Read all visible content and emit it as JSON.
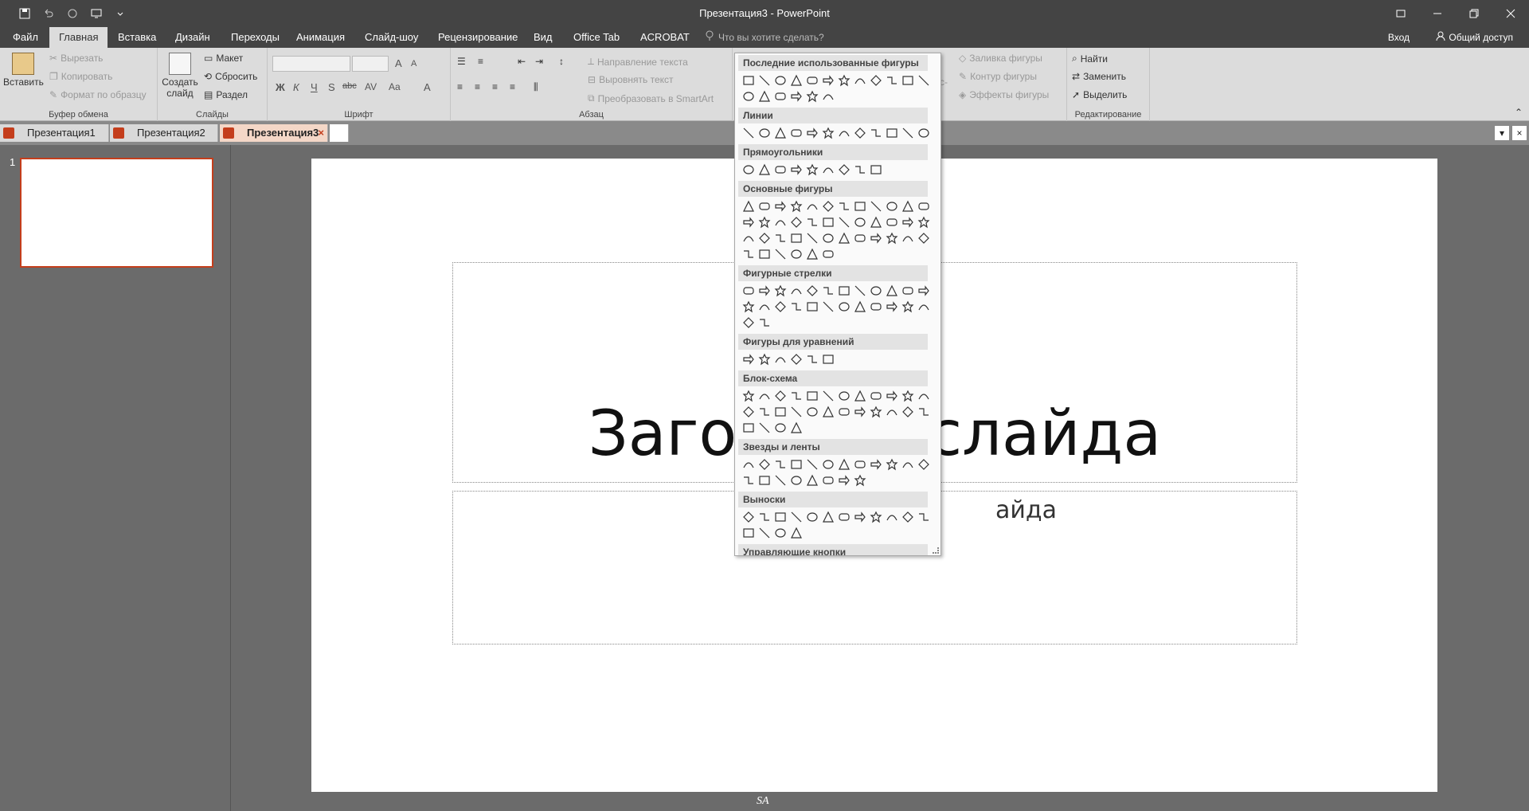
{
  "app": {
    "title": "Презентация3 - PowerPoint"
  },
  "ribbon_tabs": [
    "Файл",
    "Главная",
    "Вставка",
    "Дизайн",
    "Переходы",
    "Анимация",
    "Слайд-шоу",
    "Рецензирование",
    "Вид",
    "Office Tab",
    "ACROBAT"
  ],
  "tell_me": "Что вы хотите сделать?",
  "account": {
    "signin": "Вход",
    "share": "Общий доступ"
  },
  "clipboard": {
    "paste": "Вставить",
    "cut": "Вырезать",
    "copy": "Копировать",
    "format_painter": "Формат по образцу",
    "label": "Буфер обмена"
  },
  "slides_group": {
    "new_slide": "Создать слайд",
    "layout": "Макет",
    "reset": "Сбросить",
    "section": "Раздел",
    "label": "Слайды"
  },
  "font_group": {
    "label": "Шрифт",
    "bold": "Ж",
    "italic": "К",
    "underline": "Ч",
    "shadow": "S",
    "strike": "abc",
    "spacing": "AV",
    "case": "Aa",
    "color": "A",
    "grow": "A",
    "shrink": "A"
  },
  "paragraph_group": {
    "label": "Абзац",
    "text_direction": "Направление текста",
    "align_text": "Выровнять текст",
    "smartart": "Преобразовать в SmartArt"
  },
  "drawing_group": {
    "fill": "Заливка фигуры",
    "outline": "Контур фигуры",
    "effects": "Эффекты фигуры",
    "partial": "сс-"
  },
  "editing_group": {
    "find": "Найти",
    "replace": "Заменить",
    "select": "Выделить",
    "label": "Редактирование"
  },
  "doc_tabs": [
    {
      "label": "Презентация1",
      "active": false
    },
    {
      "label": "Презентация2",
      "active": false
    },
    {
      "label": "Презентация3",
      "active": true
    }
  ],
  "thumbnail": {
    "number": "1"
  },
  "slide": {
    "title_visible_left": "Заго",
    "title_visible_right": "слайда",
    "subtitle_visible": "айда"
  },
  "signature": "SA",
  "shapes_gallery": {
    "sections": [
      {
        "name": "Последние использованные фигуры",
        "shapes": [
          "text-box",
          "line",
          "line-diagonal",
          "rectangle",
          "oval",
          "rounded-rectangle",
          "triangle",
          "elbow-connector",
          "elbow-arrow-connector",
          "right-arrow",
          "down-arrow",
          "snip-rectangle",
          "freeform",
          "arc",
          "curve",
          "left-brace",
          "right-brace",
          "star"
        ]
      },
      {
        "name": "Линии",
        "shapes": [
          "line",
          "arrow-line",
          "double-arrow-line",
          "elbow",
          "elbow-arrow",
          "elbow-double-arrow",
          "curve-connector",
          "curve-arrow",
          "curve-double-arrow",
          "curve",
          "freeform",
          "scribble"
        ]
      },
      {
        "name": "Прямоугольники",
        "shapes": [
          "rect",
          "rounded-rect",
          "snip-one",
          "snip-two",
          "snip-diag",
          "snip-round",
          "round-one",
          "round-two",
          "round-diag"
        ]
      },
      {
        "name": "Основные фигуры",
        "shapes": [
          "text-box",
          "oval",
          "triangle",
          "right-triangle",
          "parallelogram",
          "trapezoid",
          "diamond",
          "pentagon",
          "hexagon",
          "heptagon",
          "octagon",
          "decagon",
          "dodecagon",
          "pie",
          "chord",
          "teardrop",
          "frame",
          "half-frame",
          "l-shape",
          "diag-stripe",
          "cross",
          "plaque",
          "can",
          "cube",
          "bevel",
          "donut",
          "no-symbol",
          "block-arc",
          "folded-corner",
          "smiley",
          "heart",
          "lightning",
          "sun",
          "moon",
          "cloud",
          "arc",
          "double-bracket",
          "double-brace",
          "left-bracket",
          "right-bracket",
          "left-brace",
          "right-brace"
        ]
      },
      {
        "name": "Фигурные стрелки",
        "shapes": [
          "right",
          "left",
          "up",
          "down",
          "left-right",
          "up-down",
          "quad",
          "left-right-up",
          "bent",
          "u-turn",
          "left-up",
          "bent-up",
          "curved-right",
          "curved-left",
          "curved-up",
          "curved-down",
          "striped-right",
          "notched-right",
          "pentagon",
          "chevron",
          "right-callout",
          "down-callout",
          "left-callout",
          "left-right-callout",
          "quad-callout",
          "circular"
        ]
      },
      {
        "name": "Фигуры для уравнений",
        "shapes": [
          "plus",
          "minus",
          "multiply",
          "divide",
          "equal",
          "not-equal"
        ]
      },
      {
        "name": "Блок-схема",
        "shapes": [
          "process",
          "alt-process",
          "decision",
          "data",
          "predefined",
          "internal-storage",
          "document",
          "multidoc",
          "terminator",
          "preparation",
          "manual-input",
          "manual-op",
          "connector",
          "offpage",
          "card",
          "punched-tape",
          "summing",
          "or",
          "collate",
          "sort",
          "extract",
          "merge",
          "stored-data",
          "delay",
          "seq-access",
          "magnetic-disk",
          "direct-access",
          "display"
        ]
      },
      {
        "name": "Звезды и ленты",
        "shapes": [
          "explosion1",
          "explosion2",
          "star4",
          "star5",
          "star6",
          "star7",
          "star8",
          "star10",
          "star12",
          "star16",
          "star24",
          "star32",
          "ribbon-up",
          "ribbon-down",
          "curved-up",
          "curved-down",
          "scroll-v",
          "scroll-h",
          "wave",
          "double-wave"
        ]
      },
      {
        "name": "Выноски",
        "shapes": [
          "rect-callout",
          "rounded-callout",
          "oval-callout",
          "cloud-callout",
          "line1",
          "line2",
          "line3",
          "line1-acc",
          "line2-acc",
          "line3-acc",
          "line1-border",
          "line2-border",
          "line3-border",
          "line1-both",
          "line2-both",
          "line3-both"
        ]
      },
      {
        "name": "Управляющие кнопки",
        "shapes": [
          "back",
          "forward",
          "beginning",
          "end",
          "home",
          "info",
          "return",
          "movie",
          "document",
          "sound",
          "help",
          "blank"
        ]
      }
    ]
  }
}
